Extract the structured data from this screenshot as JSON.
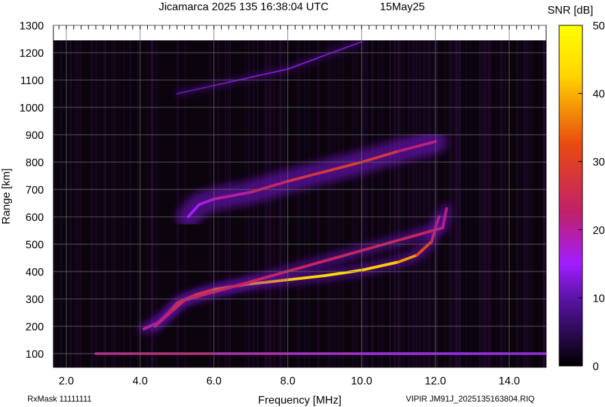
{
  "header": {
    "title": "Jicamarca 2025 135 16:38:04 UTC",
    "date": "15May25"
  },
  "footer": {
    "rxmask": "RxMask 11111111",
    "file": "VIPIR  JM91J_2025135163804.RIQ"
  },
  "colors": {
    "background": "#0b040d",
    "grid": "#6a6a6a",
    "colormap": [
      "#000000",
      "#5b14a8",
      "#a21dff",
      "#c0206a",
      "#e84a10",
      "#ffd400",
      "#ffff00"
    ]
  },
  "chart_data": {
    "type": "heatmap",
    "title": "Jicamarca 2025 135 16:38:04 UTC",
    "xlabel": "Frequency [MHz]",
    "ylabel": "Range [km]",
    "xlim": [
      1.65,
      15.0
    ],
    "ylim": [
      50,
      1300
    ],
    "xticks": [
      2.0,
      4.0,
      6.0,
      8.0,
      10.0,
      12.0,
      14.0
    ],
    "xtick_labels": [
      "2.0",
      "4.0",
      "6.0",
      "8.0",
      "10.0",
      "12.0",
      "14.0"
    ],
    "yticks": [
      100,
      200,
      300,
      400,
      500,
      600,
      700,
      800,
      900,
      1000,
      1100,
      1200,
      1300
    ],
    "grid": true,
    "colorbar": {
      "label": "SNR [dB]",
      "range": [
        0,
        50
      ],
      "ticks": [
        0,
        10,
        20,
        30,
        40,
        50
      ]
    },
    "echo_traces": [
      {
        "name": "",
        "description": "",
        "points": [
          [
            4.1,
            190
          ],
          [
            4.5,
            215
          ],
          [
            4.8,
            255
          ],
          [
            5.0,
            285
          ],
          [
            5.5,
            315
          ],
          [
            6.0,
            335
          ],
          [
            7.0,
            355
          ],
          [
            8.0,
            370
          ],
          [
            9.0,
            385
          ],
          [
            10.0,
            405
          ],
          [
            11.0,
            435
          ],
          [
            11.5,
            460
          ],
          [
            11.9,
            510
          ],
          [
            12.0,
            560
          ],
          [
            12.1,
            600
          ]
        ],
        "snr_db": [
          18,
          22,
          26,
          28,
          32,
          34,
          38,
          42,
          45,
          44,
          40,
          36,
          28,
          24,
          22
        ]
      },
      {
        "name": "",
        "points": [
          [
            4.4,
            200
          ],
          [
            4.9,
            260
          ],
          [
            5.2,
            295
          ],
          [
            12.2,
            560
          ],
          [
            12.3,
            630
          ]
        ],
        "snr_db": [
          20,
          24,
          26,
          22,
          20
        ]
      },
      {
        "name": "",
        "points": [
          [
            5.3,
            600
          ],
          [
            5.6,
            645
          ],
          [
            6.0,
            665
          ],
          [
            7.0,
            690
          ],
          [
            8.0,
            730
          ],
          [
            9.0,
            765
          ],
          [
            10.0,
            800
          ],
          [
            11.0,
            840
          ],
          [
            12.0,
            875
          ]
        ],
        "snr_db": [
          14,
          16,
          18,
          22,
          26,
          28,
          30,
          26,
          18
        ]
      },
      {
        "name": "",
        "points": [
          [
            5.0,
            1050
          ],
          [
            6.0,
            1080
          ],
          [
            7.0,
            1110
          ],
          [
            8.0,
            1140
          ],
          [
            9.0,
            1190
          ],
          [
            10.0,
            1240
          ]
        ],
        "snr_db": [
          10,
          11,
          12,
          13,
          12,
          11
        ]
      },
      {
        "name": "",
        "points": [
          [
            2.8,
            100
          ],
          [
            4.0,
            100
          ],
          [
            6.0,
            100
          ],
          [
            8.0,
            100
          ],
          [
            10.0,
            100
          ],
          [
            12.0,
            100
          ],
          [
            14.0,
            100
          ],
          [
            15.0,
            100
          ]
        ],
        "snr_db": [
          18,
          24,
          20,
          18,
          16,
          15,
          14,
          14
        ]
      }
    ]
  }
}
